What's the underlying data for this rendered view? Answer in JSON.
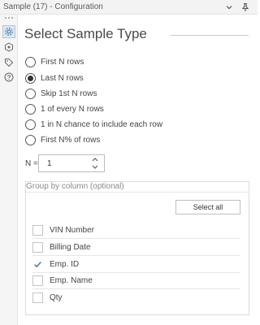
{
  "window": {
    "title": "Sample (17) - Configuration"
  },
  "header": {
    "title": "Select Sample Type"
  },
  "sample_types": [
    {
      "label": "First N rows",
      "selected": false
    },
    {
      "label": "Last N rows",
      "selected": true
    },
    {
      "label": "Skip 1st N rows",
      "selected": false
    },
    {
      "label": "1 of every N rows",
      "selected": false
    },
    {
      "label": "1 in N chance to include each row",
      "selected": false
    },
    {
      "label": "First N% of rows",
      "selected": false
    }
  ],
  "n_field": {
    "label": "N =",
    "value": "1"
  },
  "group_by": {
    "title": "Group by column (optional)",
    "select_all_label": "Select all",
    "columns": [
      {
        "label": "VIN Number",
        "checked": false
      },
      {
        "label": "Billing Date",
        "checked": false
      },
      {
        "label": "Emp. ID",
        "checked": true
      },
      {
        "label": "Emp. Name",
        "checked": false
      },
      {
        "label": "Qty",
        "checked": false
      }
    ]
  },
  "colors": {
    "accent": "#2f6fb0",
    "checkmark": "#2f5e8e",
    "text": "#404040"
  },
  "icons": {
    "collapse": "chevron-down-icon",
    "pin": "pin-icon",
    "configuration": "gear-icon",
    "output": "connection-icon",
    "annotation": "tag-icon",
    "help": "help-icon"
  }
}
